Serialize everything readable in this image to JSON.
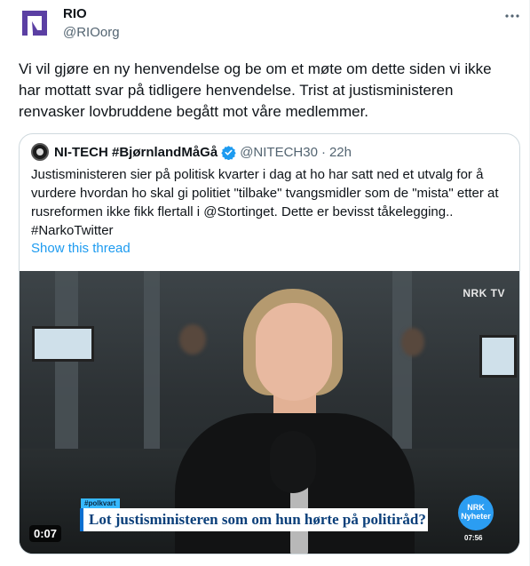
{
  "author": {
    "name": "RIO",
    "handle": "@RIOorg",
    "avatar_color": "#5b3fa3",
    "more_icon": "more-icon"
  },
  "tweet": {
    "text": "Vi vil gjøre en ny henvendelse og be om et møte om dette siden vi ikke har mottatt svar på tidligere henvendelse. Trist at justisministeren renvasker lovbruddene begått mot våre medlemmer."
  },
  "quote": {
    "name": "NI-TECH #BjørnlandMåGå",
    "verified_icon": "verified-badge-icon",
    "verified_color": "#1d9bf0",
    "handle": "@NITECH30",
    "separator": "·",
    "time": "22h",
    "text": "Justisministeren sier på politisk kvarter  i dag at ho har satt ned et utvalg for å vurdere hvordan ho skal gi politiet \"tilbake\" tvangsmidler som de \"mista\" etter at rusreformen ikke fikk flertall i @Stortinget. Dette er bevisst tåkelegging.. #NarkoTwitter",
    "show_thread": "Show this thread"
  },
  "video": {
    "channel_mark": "NRK TV",
    "hashtag": "#polkvart",
    "headline": "Lot justisministeren som om hun hørte på politiråd?",
    "logo_text": "NRK Nyheter",
    "logo_time": "07:56",
    "duration": "0:07",
    "accent": "#2b9df2"
  }
}
